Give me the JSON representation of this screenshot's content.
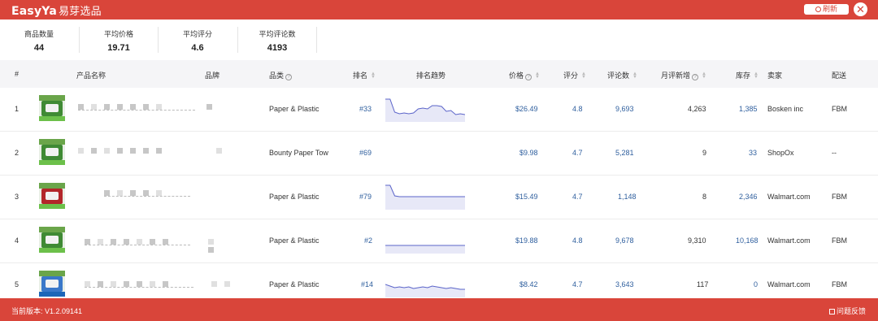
{
  "app": {
    "logo_text": "EasyYa",
    "logo_cn": "易芽选品",
    "refresh_label": "刷新",
    "close_glyph": "✕"
  },
  "stats": [
    {
      "label": "商品数量",
      "value": "44"
    },
    {
      "label": "平均价格",
      "value": "19.71"
    },
    {
      "label": "平均评分",
      "value": "4.6"
    },
    {
      "label": "平均评论数",
      "value": "4193"
    }
  ],
  "columns": {
    "index": "#",
    "name": "产品名称",
    "brand": "品牌",
    "category": "品类",
    "rank": "排名",
    "rank_trend": "排名趋势",
    "price": "价格",
    "rating": "评分",
    "reviews": "评论数",
    "monthly_reviews": "月评新增",
    "stock": "库存",
    "seller": "卖家",
    "fulfillment": "配送"
  },
  "rows": [
    {
      "index": "1",
      "category": "Paper & Plastic",
      "rank": "#33",
      "price": "$26.49",
      "rating": "4.8",
      "reviews": "9,693",
      "monthly_reviews": "4,263",
      "stock": "1,385",
      "seller": "Bosken inc",
      "fulfillment": "FBM",
      "thumb": "green",
      "trend": [
        4,
        4,
        20,
        22,
        21,
        22,
        21,
        16,
        15,
        16,
        12,
        12,
        13,
        19,
        18,
        23,
        22,
        23
      ]
    },
    {
      "index": "2",
      "category": "Bounty Paper Tow",
      "rank": "#69",
      "price": "$9.98",
      "rating": "4.7",
      "reviews": "5,281",
      "monthly_reviews": "9",
      "stock": "33",
      "seller": "ShopOx",
      "fulfillment": "--",
      "thumb": "green",
      "trend": []
    },
    {
      "index": "3",
      "category": "Paper & Plastic",
      "rank": "#79",
      "price": "$15.49",
      "rating": "4.7",
      "reviews": "1,148",
      "monthly_reviews": "8",
      "stock": "2,346",
      "seller": "Walmart.com",
      "fulfillment": "FBM",
      "thumb": "red",
      "trend": [
        2,
        2,
        15,
        16,
        16,
        16,
        16,
        16,
        16,
        16,
        16,
        16,
        16,
        16,
        16,
        16,
        16,
        16
      ]
    },
    {
      "index": "4",
      "category": "Paper & Plastic",
      "rank": "#2",
      "price": "$19.88",
      "rating": "4.8",
      "reviews": "9,678",
      "monthly_reviews": "9,310",
      "stock": "10,168",
      "seller": "Walmart.com",
      "fulfillment": "FBM",
      "thumb": "green",
      "trend": [
        22,
        22,
        22,
        22,
        22,
        22,
        22,
        22,
        22,
        22,
        22,
        22,
        22,
        22,
        22,
        22,
        22,
        22
      ]
    },
    {
      "index": "5",
      "category": "Paper & Plastic",
      "rank": "#14",
      "price": "$8.42",
      "rating": "4.7",
      "reviews": "3,643",
      "monthly_reviews": "117",
      "stock": "0",
      "seller": "Walmart.com",
      "fulfillment": "FBM",
      "thumb": "blue",
      "trend": [
        16,
        18,
        20,
        19,
        20,
        19,
        21,
        20,
        19,
        20,
        18,
        19,
        20,
        21,
        20,
        21,
        22,
        22
      ]
    }
  ],
  "footer": {
    "version": "当前版本: V1.2.09141",
    "feedback": "问题反馈"
  },
  "colors": {
    "brand": "#d9453a",
    "link": "#2f5f9e",
    "sparkline": "#5b64c9"
  }
}
